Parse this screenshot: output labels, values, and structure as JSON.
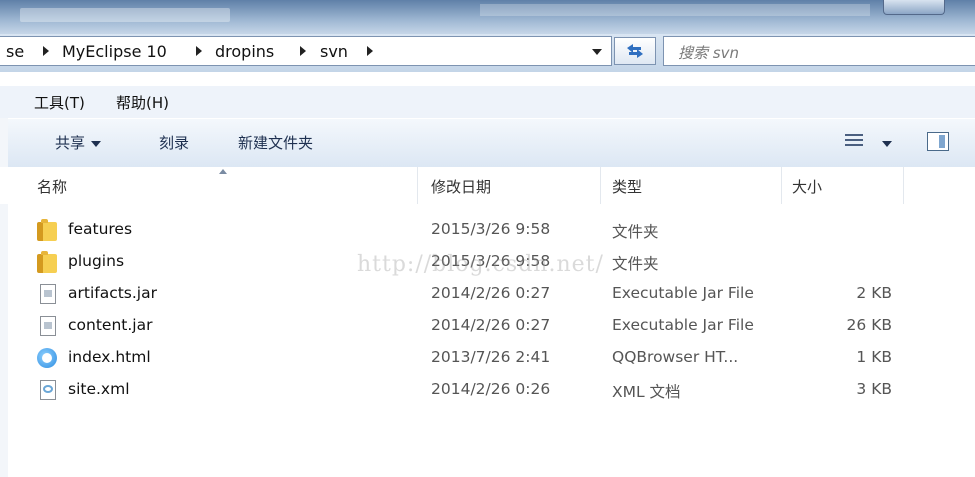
{
  "address": {
    "crumbs": [
      "se",
      "MyEclipse 10",
      "dropins",
      "svn"
    ]
  },
  "search": {
    "placeholder": "搜索 svn"
  },
  "menu": {
    "tools": "工具(T)",
    "help": "帮助(H)"
  },
  "toolbar": {
    "share": "共享",
    "burn": "刻录",
    "new_folder": "新建文件夹"
  },
  "columns": {
    "name": "名称",
    "date": "修改日期",
    "type": "类型",
    "size": "大小"
  },
  "files": [
    {
      "name": "features",
      "date": "2015/3/26 9:58",
      "type": "文件夹",
      "size": "",
      "icon": "folder-icon"
    },
    {
      "name": "plugins",
      "date": "2015/3/26 9:58",
      "type": "文件夹",
      "size": "",
      "icon": "folder-icon"
    },
    {
      "name": "artifacts.jar",
      "date": "2014/2/26 0:27",
      "type": "Executable Jar File",
      "size": "2 KB",
      "icon": "jar-file-icon"
    },
    {
      "name": "content.jar",
      "date": "2014/2/26 0:27",
      "type": "Executable Jar File",
      "size": "26 KB",
      "icon": "jar-file-icon"
    },
    {
      "name": "index.html",
      "date": "2013/7/26 2:41",
      "type": "QQBrowser HT...",
      "size": "1 KB",
      "icon": "browser-icon"
    },
    {
      "name": "site.xml",
      "date": "2014/2/26 0:26",
      "type": "XML 文档",
      "size": "3 KB",
      "icon": "xml-file-icon"
    }
  ],
  "watermark": "http://blog.csdn.net/"
}
